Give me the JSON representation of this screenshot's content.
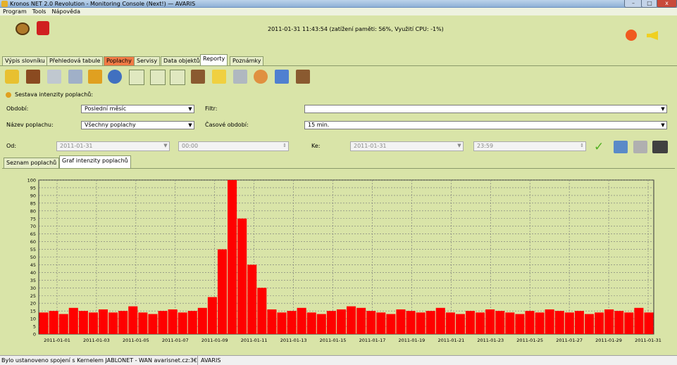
{
  "window": {
    "title": "Kronos NET 2.0 Revolution - Monitoring Console (Next!) — AVARIS",
    "buttons": [
      "–",
      "□",
      "x"
    ]
  },
  "menu": [
    "Program",
    "Tools",
    "Nápověda"
  ],
  "header": {
    "status_text": "2011-01-31 11:43:54 (zatížení paměti: 56%, Využití CPU: -1%)"
  },
  "tabs": [
    {
      "label": "Výpis slovníku"
    },
    {
      "label": "Přehledová tabule"
    },
    {
      "label": "Poplachy"
    },
    {
      "label": "Servisy"
    },
    {
      "label": "Data objektů"
    },
    {
      "label": "Reporty"
    },
    {
      "label": "Poznámky"
    }
  ],
  "toolbar_icons": [
    "speaker-icon",
    "book-icon",
    "document-icon",
    "notepad-icon",
    "swap-icon",
    "clock-alert-icon",
    "sum-icon",
    "sum-edit-icon",
    "sum-alarm-icon",
    "sum-book-icon",
    "pencil-icon",
    "pen-note-icon",
    "clock-chart-icon",
    "ruler-icon",
    "book-down-icon"
  ],
  "report": {
    "title": "Sestava intenzity poplachů:",
    "period_label": "Období:",
    "period_value": "Poslední měsíc",
    "filter_label": "Filtr:",
    "filter_value": "",
    "alarm_name_label": "Název poplachu:",
    "alarm_name_value": "Všechny poplachy",
    "time_period_label": "Časové období:",
    "time_period_value": "15 min.",
    "from_label": "Od:",
    "from_date": "2011-01-31",
    "from_time": "00:00",
    "to_label": "Ke:",
    "to_date": "2011-01-31",
    "to_time": "23:59"
  },
  "subtabs": [
    "Seznam poplachů",
    "Graf intenzity poplachů"
  ],
  "status": {
    "connection": "Bylo ustanoveno spojení s Kernelem JABLONET - WAN avarisnet.cz:3€",
    "user": "AVARIS"
  },
  "colors": {
    "background": "#d9e4a8",
    "bars": "#ff0000",
    "alarm_tab": "#f07a45"
  },
  "chart_data": {
    "type": "bar",
    "title": "",
    "xlabel": "",
    "ylabel": "",
    "ylim": [
      0,
      100
    ],
    "yticks": [
      0,
      5,
      10,
      15,
      20,
      25,
      30,
      35,
      40,
      45,
      50,
      55,
      60,
      65,
      70,
      75,
      80,
      85,
      90,
      95,
      100
    ],
    "x_tick_labels": [
      "2011-01-01",
      "2011-01-03",
      "2011-01-05",
      "2011-01-07",
      "2011-01-09",
      "2011-01-11",
      "2011-01-13",
      "2011-01-15",
      "2011-01-17",
      "2011-01-19",
      "2011-01-21",
      "2011-01-23",
      "2011-01-25",
      "2011-01-27",
      "2011-01-29",
      "2011-01-31"
    ],
    "grid": true,
    "series": [
      {
        "color": "#ff0000",
        "values": [
          14,
          15,
          13,
          17,
          15,
          14,
          16,
          14,
          15,
          18,
          14,
          13,
          15,
          16,
          14,
          15,
          17,
          24,
          55,
          100,
          75,
          45,
          30,
          16,
          14,
          15,
          17,
          14,
          13,
          15,
          16,
          18,
          17,
          15,
          14,
          13,
          16,
          15,
          14,
          15,
          17,
          14,
          13,
          15,
          14,
          16,
          15,
          14,
          13,
          15,
          14,
          16,
          15,
          14,
          15,
          13,
          14,
          16,
          15,
          14,
          17,
          14
        ]
      }
    ]
  }
}
